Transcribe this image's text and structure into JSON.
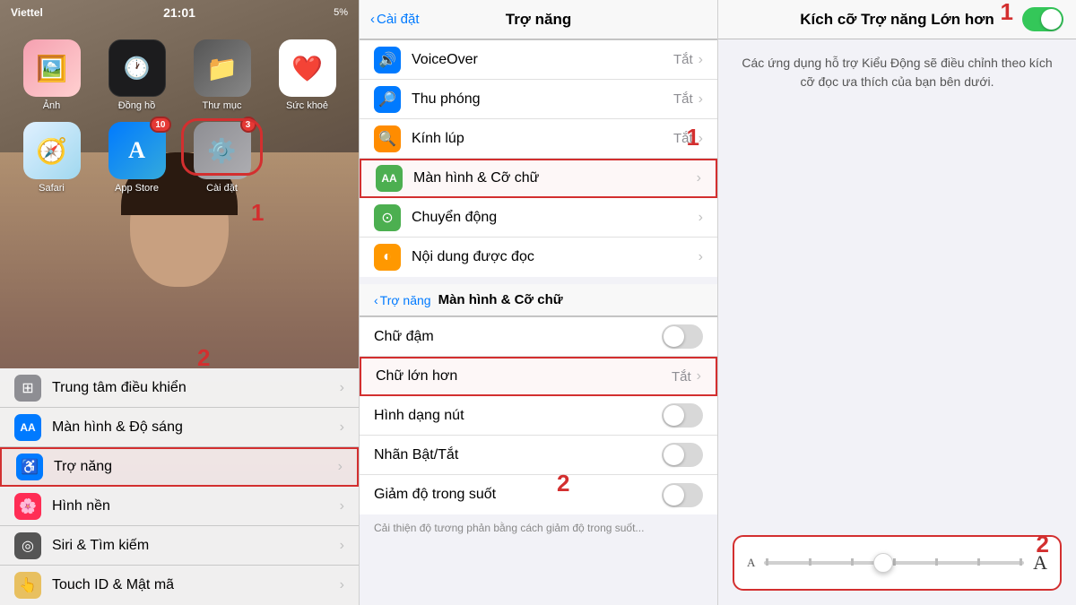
{
  "home": {
    "status": {
      "carrier": "Viettel",
      "time": "21:01",
      "battery": "5%"
    },
    "apps_row1": [
      {
        "label": "Ảnh",
        "color": "#f0a0a0",
        "emoji": "🖼️",
        "badge": ""
      },
      {
        "label": "Đồng hồ",
        "color": "#1c1c1e",
        "emoji": "🕐",
        "badge": ""
      },
      {
        "label": "Thư mục",
        "color": "#5b5b5b",
        "emoji": "📁",
        "badge": ""
      },
      {
        "label": "Sức khoẻ",
        "color": "#ff2d55",
        "emoji": "❤️",
        "badge": ""
      }
    ],
    "apps_row2": [
      {
        "label": "Safari",
        "color": "#007aff",
        "emoji": "🧭",
        "badge": ""
      },
      {
        "label": "App Store",
        "color": "#007aff",
        "emoji": "A",
        "badge": "10"
      },
      {
        "label": "Cài đặt",
        "color": "#8e8e93",
        "emoji": "⚙️",
        "badge": "3",
        "highlight": true
      }
    ],
    "settings_items": [
      {
        "label": "Trung tâm điều khiển",
        "iconColor": "#8e8e93",
        "emoji": "⊞"
      },
      {
        "label": "Màn hình & Độ sáng",
        "iconColor": "#007aff",
        "emoji": "AA"
      },
      {
        "label": "Trợ năng",
        "iconColor": "#007aff",
        "emoji": "♿",
        "highlight": true
      },
      {
        "label": "Hình nền",
        "iconColor": "#ff2d55",
        "emoji": "🌸"
      },
      {
        "label": "Siri & Tìm kiếm",
        "iconColor": "#555",
        "emoji": "◎"
      },
      {
        "label": "Touch ID & Mật mã",
        "iconColor": "#e8c060",
        "emoji": "👆"
      }
    ],
    "step1_label": "1",
    "step2_label": "2"
  },
  "tro_nang": {
    "nav_title": "Trợ năng",
    "back_label": "Cài đặt",
    "items": [
      {
        "label": "VoiceOver",
        "iconColor": "#007aff",
        "emoji": "🔊",
        "value": "Tắt"
      },
      {
        "label": "Thu phóng",
        "iconColor": "#007aff",
        "emoji": "🔎",
        "value": "Tắt"
      },
      {
        "label": "Kính lúp",
        "iconColor": "#ff8c00",
        "emoji": "🔍",
        "value": "Tắt"
      },
      {
        "label": "Màn hình & Cỡ chữ",
        "iconColor": "#4caf50",
        "emoji": "AA",
        "value": "",
        "highlight": true
      },
      {
        "label": "Chuyển động",
        "iconColor": "#4caf50",
        "emoji": "⊙",
        "value": ""
      },
      {
        "label": "Nội dung được đọc",
        "iconColor": "#ff9800",
        "emoji": "◐",
        "value": ""
      }
    ],
    "step1_label": "1",
    "sub_nav": {
      "back_label": "Trợ năng",
      "title": "Màn hình & Cỡ chữ"
    },
    "sub_items": [
      {
        "label": "Chữ đậm",
        "type": "toggle"
      },
      {
        "label": "Chữ lớn hơn",
        "type": "value",
        "value": "Tắt",
        "highlight": true
      },
      {
        "label": "Hình dạng nút",
        "type": "toggle"
      },
      {
        "label": "Nhãn Bật/Tắt",
        "type": "toggle"
      },
      {
        "label": "Giảm độ trong suốt",
        "type": "toggle"
      }
    ],
    "step2_label": "2"
  },
  "right_panel": {
    "nav_title": "Kích cỡ Trợ năng Lớn hơn",
    "toggle_on": true,
    "description": "Các ứng dụng hỗ trợ Kiểu Động sẽ điều chỉnh theo kích cỡ đọc ưa thích của bạn bên dưới.",
    "slider": {
      "small_a": "A",
      "large_a": "A",
      "thumb_position": "42%"
    },
    "step1_label": "1",
    "step2_label": "2"
  }
}
